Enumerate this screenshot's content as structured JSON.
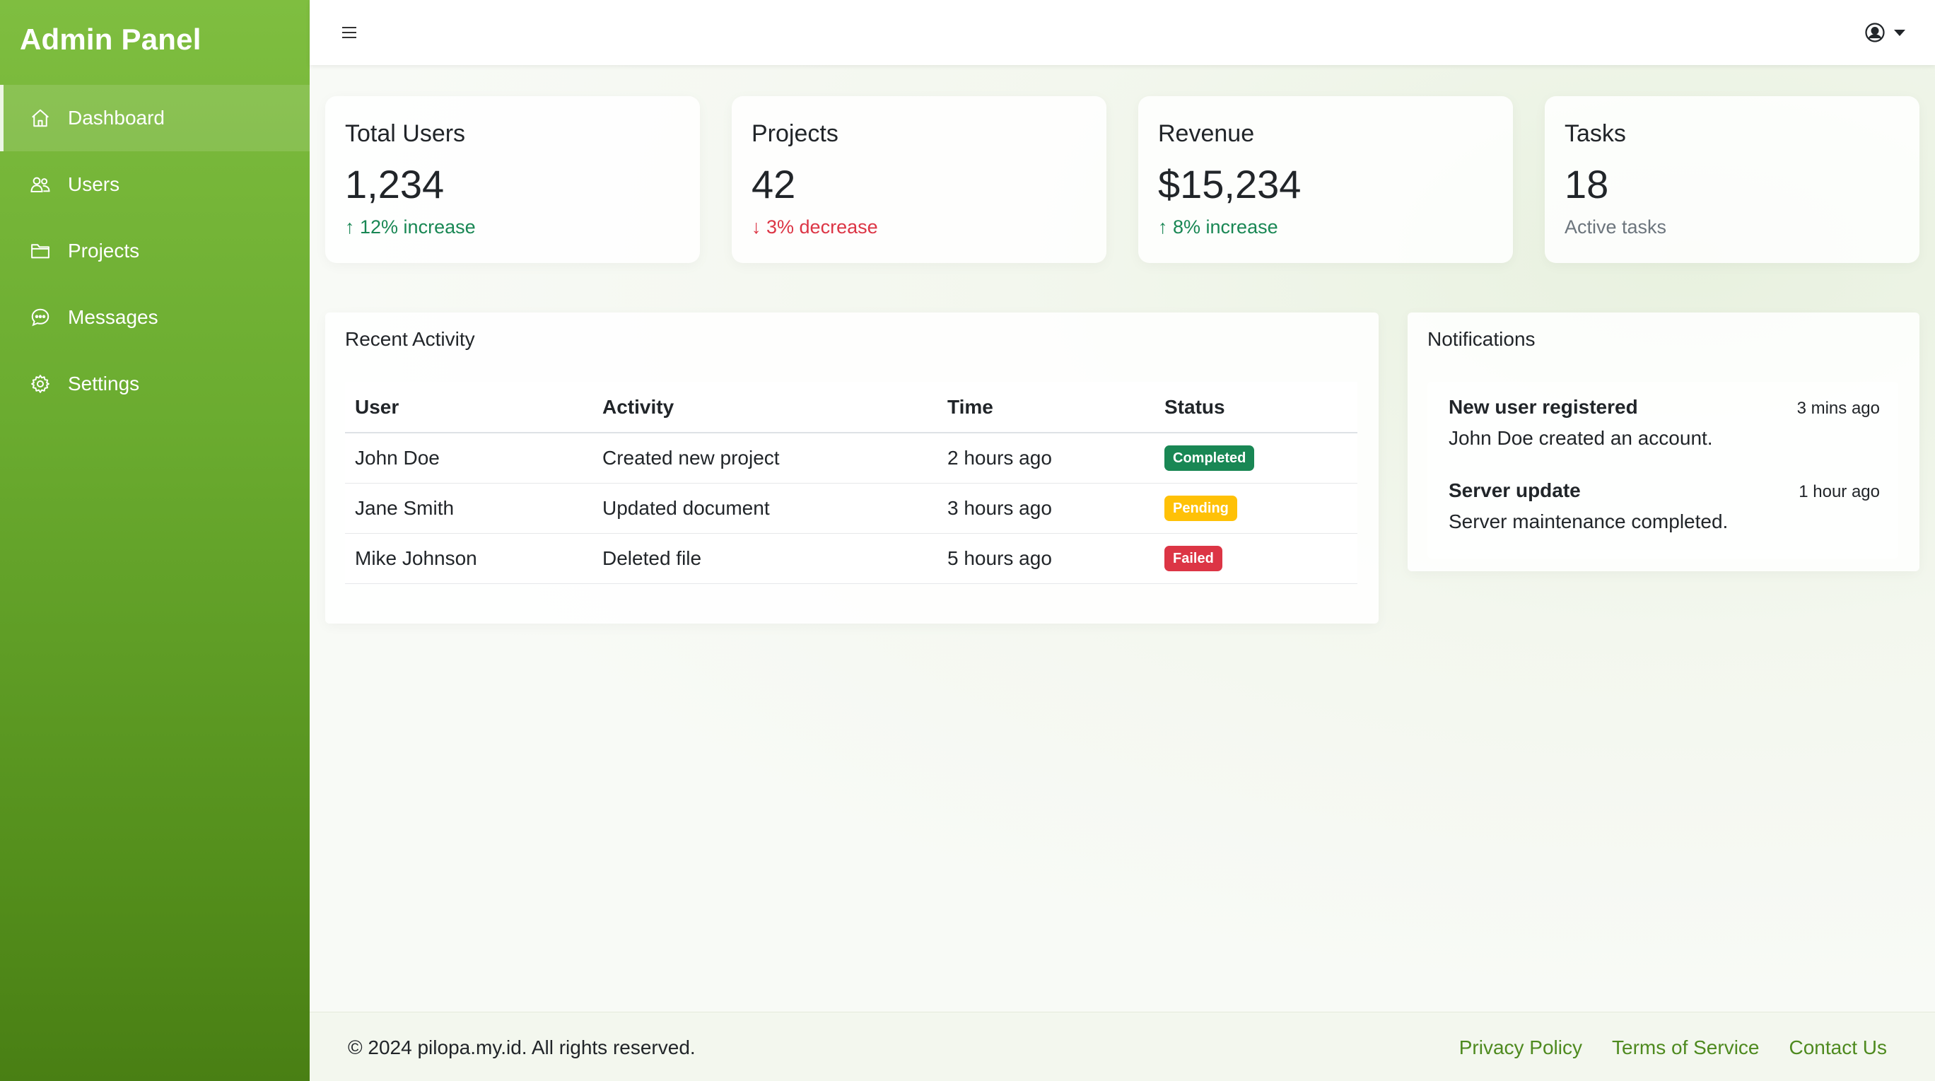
{
  "sidebar": {
    "brand": "Admin Panel",
    "items": [
      {
        "label": "Dashboard",
        "icon": "home-icon",
        "active": true
      },
      {
        "label": "Users",
        "icon": "users-icon"
      },
      {
        "label": "Projects",
        "icon": "folder-icon"
      },
      {
        "label": "Messages",
        "icon": "chat-icon"
      },
      {
        "label": "Settings",
        "icon": "gear-icon"
      }
    ]
  },
  "topbar": {
    "menu_icon": "hamburger-icon",
    "user_icon": "user-circle-icon"
  },
  "stats": [
    {
      "title": "Total Users",
      "value": "1,234",
      "change": "12% increase",
      "direction": "up"
    },
    {
      "title": "Projects",
      "value": "42",
      "change": "3% decrease",
      "direction": "down"
    },
    {
      "title": "Revenue",
      "value": "$15,234",
      "change": "8% increase",
      "direction": "up"
    },
    {
      "title": "Tasks",
      "value": "18",
      "change": "Active tasks",
      "direction": "none"
    }
  ],
  "activity": {
    "title": "Recent Activity",
    "columns": [
      "User",
      "Activity",
      "Time",
      "Status"
    ],
    "rows": [
      {
        "user": "John Doe",
        "activity": "Created new project",
        "time": "2 hours ago",
        "status": "Completed"
      },
      {
        "user": "Jane Smith",
        "activity": "Updated document",
        "time": "3 hours ago",
        "status": "Pending"
      },
      {
        "user": "Mike Johnson",
        "activity": "Deleted file",
        "time": "5 hours ago",
        "status": "Failed"
      }
    ]
  },
  "notifications": {
    "title": "Notifications",
    "items": [
      {
        "title": "New user registered",
        "time": "3 mins ago",
        "text": "John Doe created an account."
      },
      {
        "title": "Server update",
        "time": "1 hour ago",
        "text": "Server maintenance completed."
      }
    ]
  },
  "footer": {
    "copyright": "© 2024 pilopa.my.id. All rights reserved.",
    "links": [
      "Privacy Policy",
      "Terms of Service",
      "Contact Us"
    ]
  },
  "colors": {
    "sidebar_top": "#7fbe40",
    "sidebar_bottom": "#497f14",
    "success": "#198754",
    "warning": "#ffc107",
    "danger": "#dc3545",
    "link": "#4e8a1f"
  }
}
